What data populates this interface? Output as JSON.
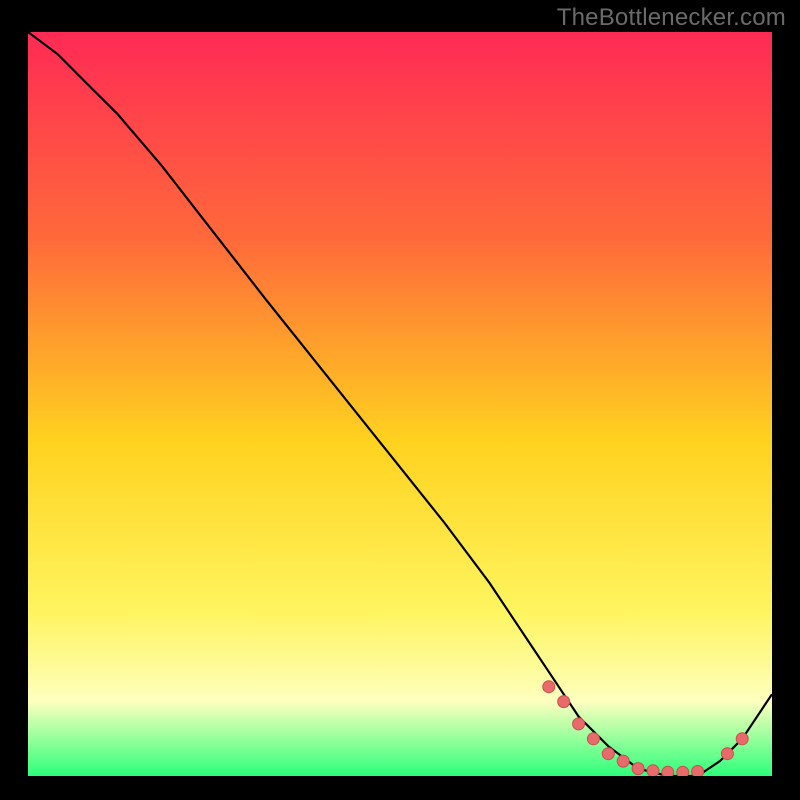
{
  "watermark": "TheBottlenecker.com",
  "colors": {
    "bg_black": "#000000",
    "grad_top": "#ff2a55",
    "grad_mid1": "#ff6a3a",
    "grad_mid2": "#ffd21f",
    "grad_low1": "#fff560",
    "grad_low2": "#fdffbe",
    "grad_bottom": "#2dff7a",
    "curve": "#000000",
    "marker_fill": "#e86a6a",
    "marker_stroke": "#c94f4f"
  },
  "chart_data": {
    "type": "line",
    "title": "",
    "xlabel": "",
    "ylabel": "",
    "xlim": [
      0,
      100
    ],
    "ylim": [
      0,
      100
    ],
    "grid": false,
    "legend": false,
    "series": [
      {
        "name": "curve",
        "x": [
          0,
          4,
          8,
          12,
          18,
          25,
          32,
          40,
          48,
          56,
          62,
          66,
          70,
          74,
          78,
          82,
          86,
          90,
          93,
          96,
          100
        ],
        "y": [
          100,
          97,
          93,
          89,
          82,
          73,
          64,
          54,
          44,
          34,
          26,
          20,
          14,
          8,
          4,
          1,
          0,
          0,
          2,
          5,
          11
        ]
      }
    ],
    "markers": {
      "name": "highlight-points",
      "x": [
        70,
        72,
        74,
        76,
        78,
        80,
        82,
        84,
        86,
        88,
        90,
        94,
        96
      ],
      "y": [
        12,
        10,
        7,
        5,
        3,
        2,
        1,
        0.7,
        0.5,
        0.5,
        0.6,
        3,
        5
      ]
    }
  }
}
